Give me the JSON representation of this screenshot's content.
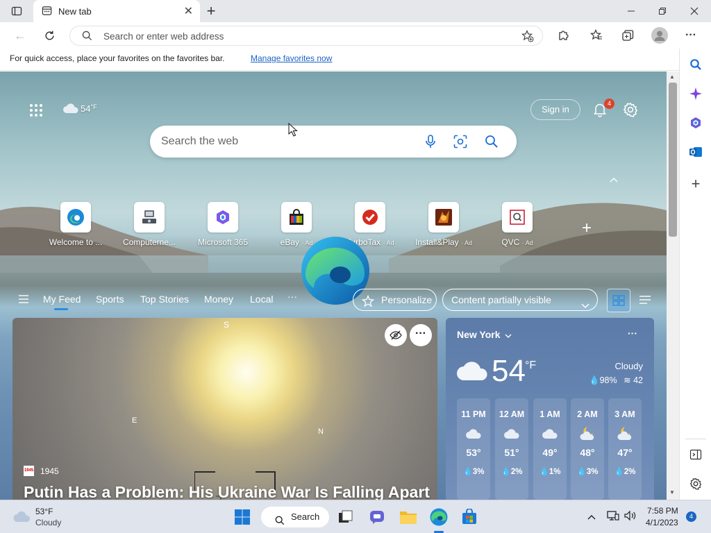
{
  "browser": {
    "tab_title": "New tab",
    "address_placeholder": "Search or enter web address",
    "favbar_text": "For quick access, place your favorites on the favorites bar.",
    "favbar_link": "Manage favorites now"
  },
  "ntp": {
    "weather_temp": "54",
    "weather_unit": "°F",
    "signin_label": "Sign in",
    "notification_count": "4",
    "search_placeholder": "Search the web",
    "tiles": [
      {
        "label": "Welcome to ...",
        "ad": ""
      },
      {
        "label": "Computerne...",
        "ad": ""
      },
      {
        "label": "Microsoft 365",
        "ad": ""
      },
      {
        "label": "eBay",
        "ad": "· Ad"
      },
      {
        "label": "TurboTax",
        "ad": "· Ad"
      },
      {
        "label": "Install&Play",
        "ad": "· Ad"
      },
      {
        "label": "QVC",
        "ad": "· Ad"
      }
    ],
    "feed_tabs": [
      "My Feed",
      "Sports",
      "Top Stories",
      "Money",
      "Local",
      "···"
    ],
    "personalize_label": "Personalize",
    "content_visibility": "Content partially visible"
  },
  "hero": {
    "source_badge": "1945",
    "source": "1945",
    "headline": "Putin Has a Problem: His Ukraine War Is Falling Apart",
    "compass": {
      "n": "S",
      "w": "E",
      "e": "N"
    }
  },
  "weather_card": {
    "city": "New York",
    "temp": "54",
    "unit": "°F",
    "condition": "Cloudy",
    "humidity": "98%",
    "wind": "42",
    "hours": [
      {
        "time": "11 PM",
        "temp": "53°",
        "precip": "3%",
        "icon": "cloud"
      },
      {
        "time": "12 AM",
        "temp": "51°",
        "precip": "2%",
        "icon": "cloud"
      },
      {
        "time": "1 AM",
        "temp": "49°",
        "precip": "1%",
        "icon": "cloud"
      },
      {
        "time": "2 AM",
        "temp": "48°",
        "precip": "3%",
        "icon": "moon-cloud"
      },
      {
        "time": "3 AM",
        "temp": "47°",
        "precip": "2%",
        "icon": "moon-cloud"
      }
    ]
  },
  "taskbar": {
    "weather_temp": "53°F",
    "weather_cond": "Cloudy",
    "search_label": "Search",
    "time": "7:58 PM",
    "date": "4/1/2023",
    "notif_count": "4"
  }
}
